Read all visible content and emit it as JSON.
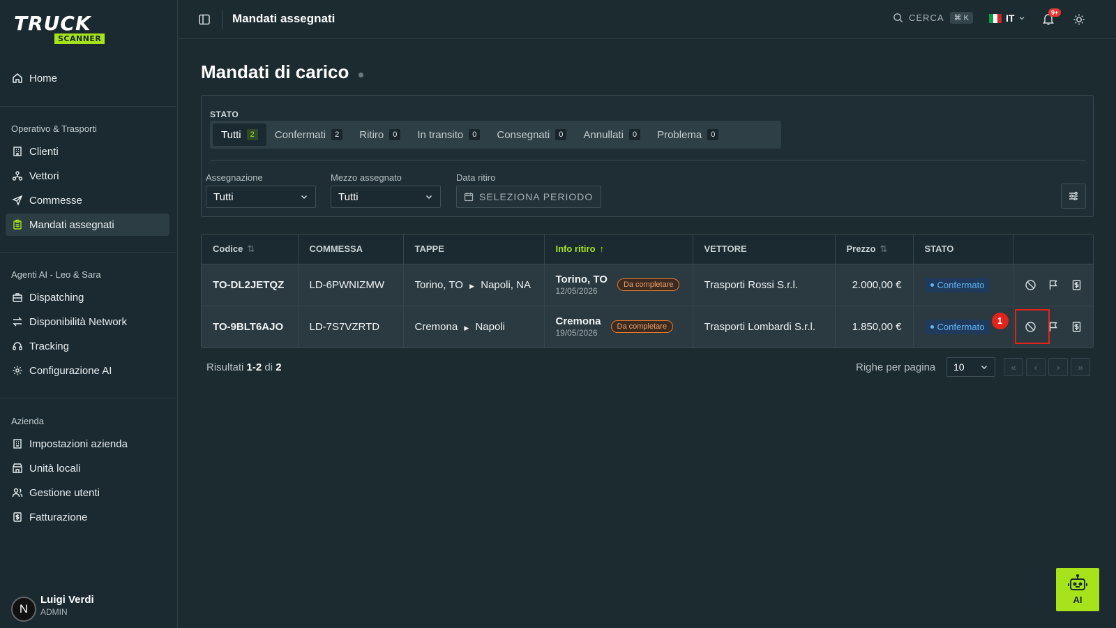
{
  "brand": {
    "name": "TRUCK",
    "sub": "SCANNER"
  },
  "sidebar": {
    "home": "Home",
    "sections": [
      {
        "label": "Operativo & Trasporti",
        "items": [
          "Clienti",
          "Vettori",
          "Commesse",
          "Mandati assegnati"
        ]
      },
      {
        "label": "Agenti AI - Leo & Sara",
        "items": [
          "Dispatching",
          "Disponibilità Network",
          "Tracking",
          "Configurazione AI"
        ]
      },
      {
        "label": "Azienda",
        "items": [
          "Impostazioni azienda",
          "Unità locali",
          "Gestione utenti",
          "Fatturazione"
        ]
      }
    ],
    "active": "Mandati assegnati",
    "user": {
      "initial": "N",
      "name": "Luigi Verdi",
      "role": "ADMIN"
    }
  },
  "topbar": {
    "title": "Mandati assegnati",
    "search_label": "CERCA",
    "search_shortcut": "⌘ K",
    "language": "IT",
    "notifications": "9+"
  },
  "page": {
    "title": "Mandati di carico"
  },
  "filters": {
    "status_label": "STATO",
    "tabs": [
      {
        "label": "Tutti",
        "count": "2"
      },
      {
        "label": "Confermati",
        "count": "2"
      },
      {
        "label": "Ritiro",
        "count": "0"
      },
      {
        "label": "In transito",
        "count": "0"
      },
      {
        "label": "Consegnati",
        "count": "0"
      },
      {
        "label": "Annullati",
        "count": "0"
      },
      {
        "label": "Problema",
        "count": "0"
      }
    ],
    "assignment_label": "Assegnazione",
    "assignment_value": "Tutti",
    "vehicle_label": "Mezzo assegnato",
    "vehicle_value": "Tutti",
    "date_label": "Data ritiro",
    "date_button": "SELEZIONA PERIODO"
  },
  "table": {
    "headers": {
      "code": "Codice",
      "order": "COMMESSA",
      "stops": "TAPPE",
      "pickup": "Info ritiro",
      "carrier": "VETTORE",
      "price": "Prezzo",
      "status": "STATO"
    },
    "rows": [
      {
        "code": "TO-DL2JETQZ",
        "order": "LD-6PWNIZMW",
        "from": "Torino, TO",
        "to": "Napoli, NA",
        "pickup_city": "Torino, TO",
        "pickup_date": "12/05/2026",
        "pickup_badge": "Da completare",
        "carrier": "Trasporti Rossi S.r.l.",
        "price": "2.000,00 €",
        "status": "Confermato"
      },
      {
        "code": "TO-9BLT6AJO",
        "order": "LD-7S7VZRTD",
        "from": "Cremona",
        "to": "Napoli",
        "pickup_city": "Cremona",
        "pickup_date": "19/05/2026",
        "pickup_badge": "Da completare",
        "carrier": "Trasporti Lombardi S.r.l.",
        "price": "1.850,00 €",
        "status": "Confermato"
      }
    ],
    "marker": "1"
  },
  "pagination": {
    "results_prefix": "Risultati",
    "results_range": "1-2",
    "results_of": "di",
    "results_total": "2",
    "rows_label": "Righe per pagina",
    "rows_value": "10"
  },
  "ai_button": "AI",
  "colors": {
    "accent": "#a6e31a",
    "badge_warn": "#e6792d",
    "status_blue": "#64b5f6",
    "marker_red": "#e3241b"
  }
}
